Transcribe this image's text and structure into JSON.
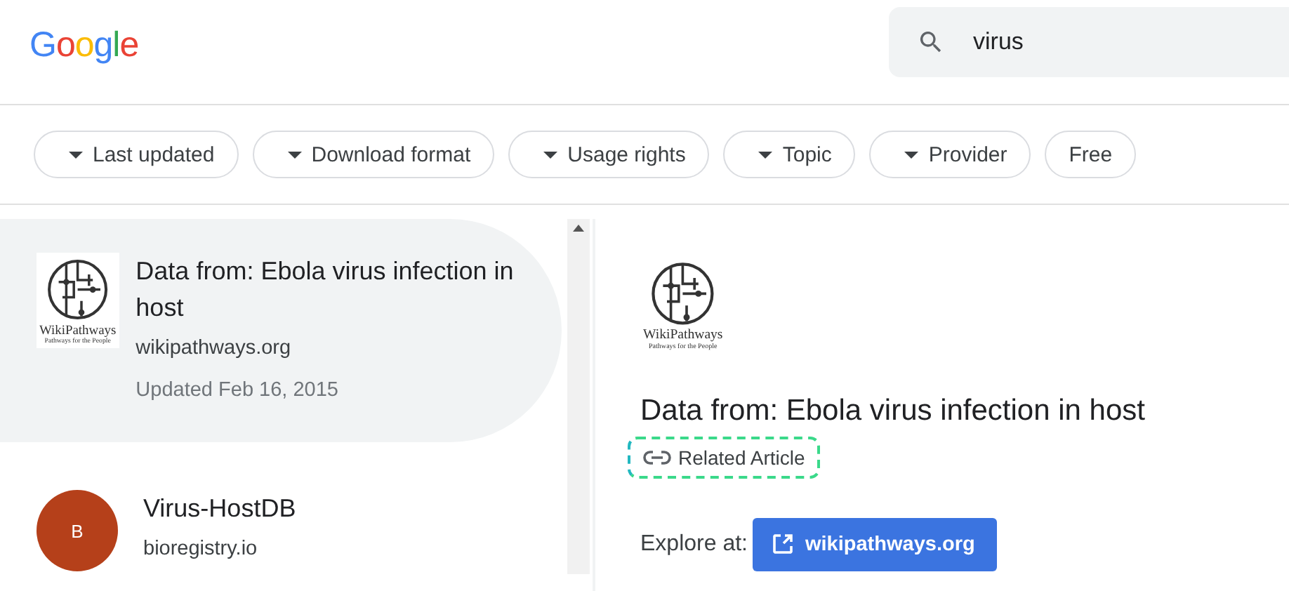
{
  "header": {
    "logo": "Google",
    "search": {
      "value": "virus"
    }
  },
  "filters": [
    {
      "label": "Last updated",
      "kind": "dropdown"
    },
    {
      "label": "Download format",
      "kind": "dropdown"
    },
    {
      "label": "Usage rights",
      "kind": "dropdown"
    },
    {
      "label": "Topic",
      "kind": "dropdown"
    },
    {
      "label": "Provider",
      "kind": "dropdown"
    },
    {
      "label": "Free",
      "kind": "toggle"
    }
  ],
  "results": [
    {
      "title": "Data from: Ebola virus infection in host",
      "source": "wikipathways.org",
      "updated": "Updated Feb 16, 2015",
      "thumb": {
        "kind": "logo",
        "name": "WikiPathways",
        "tagline": "Pathways for the People"
      },
      "selected": true
    },
    {
      "title": "Virus-HostDB",
      "source": "bioregistry.io",
      "thumb": {
        "kind": "avatar",
        "letter": "B",
        "color": "#b5401a"
      },
      "selected": false
    }
  ],
  "detail": {
    "logo": {
      "name": "WikiPathways",
      "tagline": "Pathways for the People"
    },
    "title": "Data from: Ebola virus infection in host",
    "related_link": "Related Article",
    "explore_label": "Explore at:",
    "explore_button": "wikipathways.org"
  }
}
